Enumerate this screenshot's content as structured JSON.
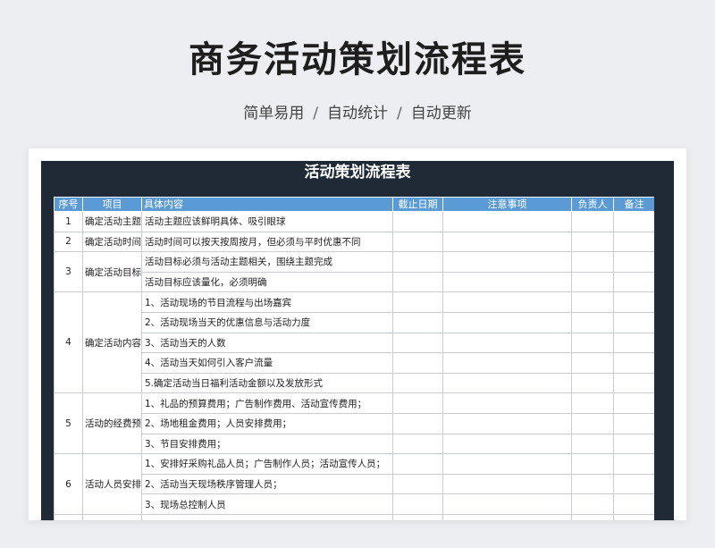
{
  "header": {
    "title": "商务活动策划流程表",
    "features": [
      "简单易用",
      "自动统计",
      "自动更新"
    ],
    "separator": "/"
  },
  "sheet": {
    "title": "活动策划流程表",
    "columns": [
      "序号",
      "项目",
      "具体内容",
      "截止日期",
      "注意事项",
      "负责人",
      "备注"
    ],
    "groups": [
      {
        "no": "1",
        "item": "确定活动主题",
        "contents": [
          "活动主题应该鲜明具体、吸引眼球"
        ]
      },
      {
        "no": "2",
        "item": "确定活动时间",
        "contents": [
          "活动时间可以按天按周按月，但必须与平时优惠不同"
        ]
      },
      {
        "no": "3",
        "item": "确定活动目标",
        "contents": [
          "活动目标必须与活动主题相关，围绕主题完成",
          "活动目标应该量化，必须明确"
        ]
      },
      {
        "no": "4",
        "item": "确定活动内容",
        "contents": [
          "1、活动现场的节目流程与出场嘉宾",
          "2、活动现场当天的优惠信息与活动力度",
          "3、活动当天的人数",
          "4、活动当天如何引入客户流量",
          "5.确定活动当日福利活动金额以及发放形式"
        ]
      },
      {
        "no": "5",
        "item": "活动的经费预算",
        "contents": [
          "1、礼品的预算费用；广告制作费用、活动宣传费用；",
          "2、场地租金费用；人员安排费用；",
          "3、节目安排费用；"
        ]
      },
      {
        "no": "6",
        "item": "活动人员安排",
        "contents": [
          "1、安排好采购礼品人员；广告制作人员；活动宣传人员；",
          "2、活动当天现场秩序管理人员；",
          "3、现场总控制人员"
        ]
      }
    ]
  }
}
